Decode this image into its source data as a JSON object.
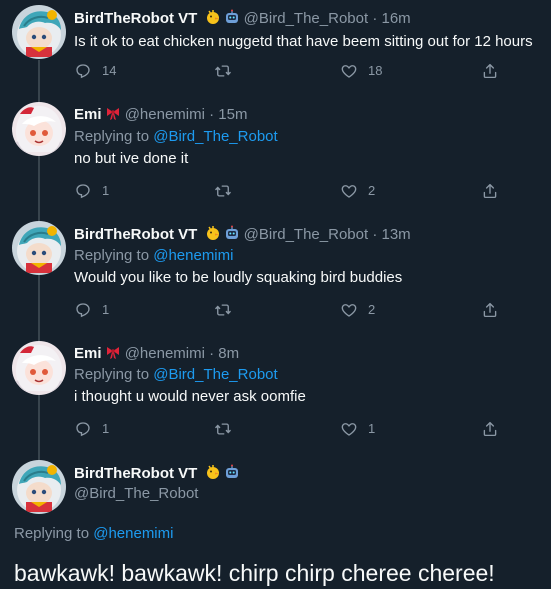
{
  "tweets": [
    {
      "name": "BirdTheRobot VT",
      "handle": "@Bird_The_Robot",
      "sep": "·",
      "time": "16m",
      "replying_label": "",
      "replying_handle": "",
      "text": "Is it ok to eat chicken nuggetd that have beem sitting out for 12 hours",
      "replies": "14",
      "retweets": "",
      "likes": "18",
      "avatar": "bird-avatar",
      "name_emojis": [
        "chick-emoji",
        "robot-emoji"
      ]
    },
    {
      "name": "Emi",
      "handle": "@henemimi",
      "sep": "·",
      "time": "15m",
      "replying_label": "Replying to",
      "replying_handle": "@Bird_The_Robot",
      "text": "no but ive done it",
      "replies": "1",
      "retweets": "",
      "likes": "2",
      "avatar": "emi-avatar",
      "name_emojis": [
        "ribbon-emoji"
      ]
    },
    {
      "name": "BirdTheRobot VT",
      "handle": "@Bird_The_Robot",
      "sep": "·",
      "time": "13m",
      "replying_label": "Replying to",
      "replying_handle": "@henemimi",
      "text": "Would you like to be loudly squaking bird buddies",
      "replies": "1",
      "retweets": "",
      "likes": "2",
      "avatar": "bird-avatar",
      "name_emojis": [
        "chick-emoji",
        "robot-emoji"
      ]
    },
    {
      "name": "Emi",
      "handle": "@henemimi",
      "sep": "·",
      "time": "8m",
      "replying_label": "Replying to",
      "replying_handle": "@Bird_The_Robot",
      "text": "i thought u would never ask oomfie",
      "replies": "1",
      "retweets": "",
      "likes": "1",
      "avatar": "emi-avatar",
      "name_emojis": [
        "ribbon-emoji"
      ]
    }
  ],
  "main": {
    "name": "BirdTheRobot VT",
    "handle": "@Bird_The_Robot",
    "replying_label": "Replying to",
    "replying_handle": "@henemimi",
    "text": "bawkawk! bawkawk! chirp chirp cheree cheree!",
    "avatar": "bird-avatar",
    "name_emojis": [
      "chick-emoji",
      "robot-emoji"
    ]
  },
  "colors": {
    "background": "#15202b",
    "text": "#f7f9f9",
    "secondary": "#8b98a5",
    "link": "#1d9bf0",
    "divider": "#38444d"
  }
}
